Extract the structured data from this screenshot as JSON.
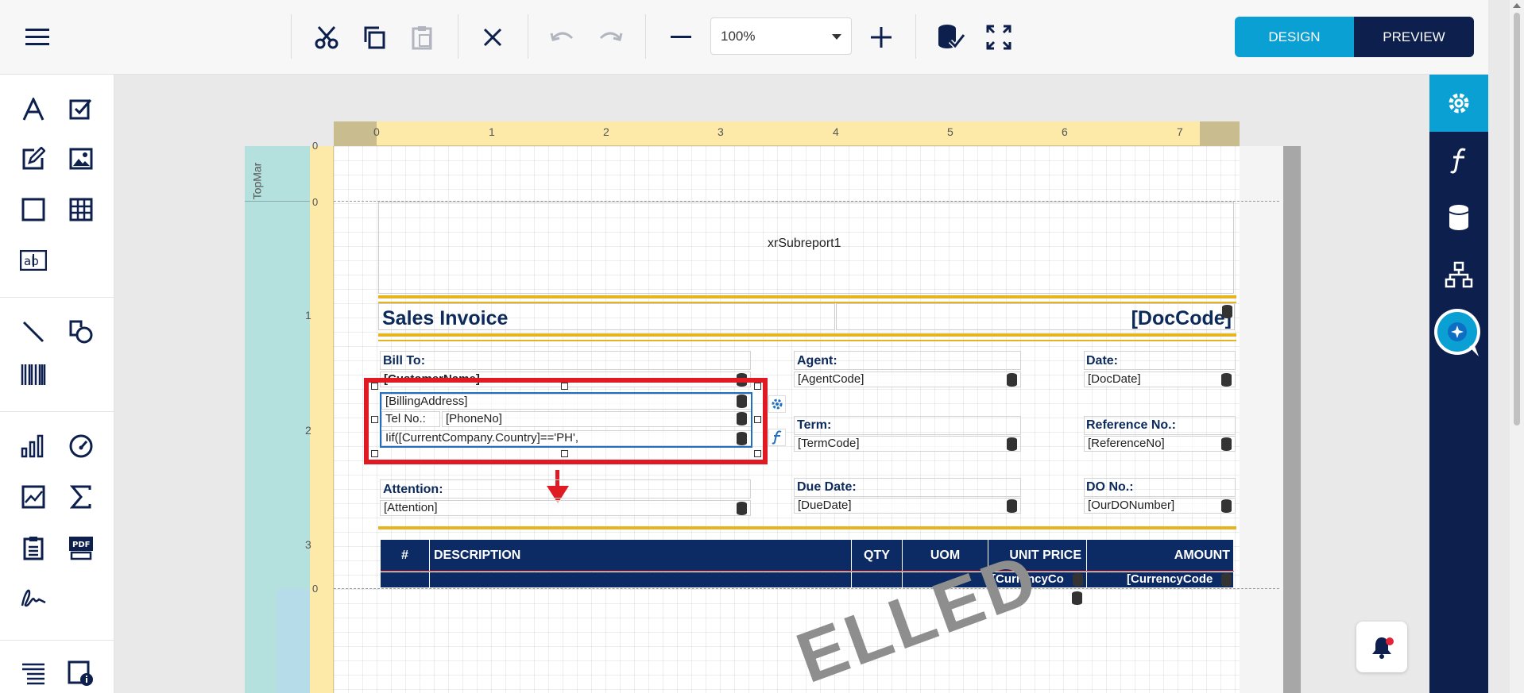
{
  "toolbar": {
    "zoom_value": "100%",
    "design_label": "DESIGN",
    "preview_label": "PREVIEW"
  },
  "rulers": {
    "h_ticks": [
      "0",
      "1",
      "2",
      "3",
      "4",
      "5",
      "6",
      "7"
    ],
    "v_ticks": [
      "0",
      "0",
      "1",
      "2",
      "3",
      "0"
    ],
    "band_label": "TopMar"
  },
  "report": {
    "subreport": "xrSubreport1",
    "title": "Sales Invoice",
    "doc_code": "[DocCode]",
    "bill_to_label": "Bill To:",
    "customer_name": "[CustomerName]",
    "billing_address": "[BillingAddress]",
    "tel_label": "Tel No.:",
    "phone": "[PhoneNo]",
    "iif_expr": "Iif([CurrentCompany.Country]=='PH',",
    "attention_label": "Attention:",
    "attention": "[Attention]",
    "agent_label": "Agent:",
    "agent": "[AgentCode]",
    "term_label": "Term:",
    "term": "[TermCode]",
    "due_label": "Due Date:",
    "due": "[DueDate]",
    "date_label": "Date:",
    "date": "[DocDate]",
    "ref_label": "Reference No.:",
    "ref": "[ReferenceNo]",
    "do_label": "DO No.:",
    "do_no": "[OurDONumber]",
    "columns": [
      "#",
      "DESCRIPTION",
      "QTY",
      "UOM",
      "UNIT PRICE",
      "AMOUNT"
    ],
    "currency_1": "[CurrencyCo",
    "currency_2": "[CurrencyCode",
    "watermark": "ELLED"
  },
  "colors": {
    "accent": "#0aa0d4",
    "navy": "#0c1f4d",
    "gold": "#e7b420",
    "highlight": "#e01a22"
  },
  "icons": {
    "left": [
      "text-icon",
      "checkbox-icon",
      "rich-text-icon",
      "picture-icon",
      "panel-icon",
      "table-icon",
      "label-icon",
      "line-icon",
      "shape-icon",
      "barcode-icon",
      "chart-icon",
      "gauge-icon",
      "sparkline-icon",
      "summary-icon",
      "subreport-icon",
      "pdf-icon",
      "signature-icon",
      "toc-icon",
      "page-info-icon"
    ],
    "right": [
      "settings-icon",
      "expression-icon",
      "database-icon",
      "report-explorer-icon",
      "ai-chat-icon"
    ]
  }
}
